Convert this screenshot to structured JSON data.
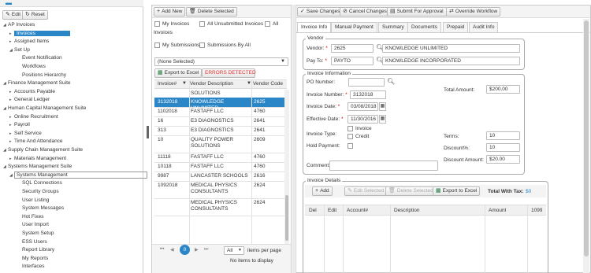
{
  "sidebar": {
    "edit_label": "Edit",
    "reset_label": "Reset",
    "items": [
      {
        "label": "AP Invoices",
        "level": 0
      },
      {
        "label": "Invoices",
        "level": 1,
        "selected": true
      },
      {
        "label": "Assigned Items",
        "level": 1
      },
      {
        "label": "Set Up",
        "level": 1
      },
      {
        "label": "Event Notification",
        "level": 2
      },
      {
        "label": "Workflows",
        "level": 2
      },
      {
        "label": "Positions Hierarchy",
        "level": 2
      },
      {
        "label": "Finance Management Suite",
        "level": 0
      },
      {
        "label": "Accounts Payable",
        "level": 1
      },
      {
        "label": "General Ledger",
        "level": 1
      },
      {
        "label": "Human Capital Management Suite",
        "level": 0
      },
      {
        "label": "Online Recruitment",
        "level": 1
      },
      {
        "label": "Payroll",
        "level": 1
      },
      {
        "label": "Self Service",
        "level": 1
      },
      {
        "label": "Time And Attendance",
        "level": 1
      },
      {
        "label": "Supply Chain Management Suite",
        "level": 0
      },
      {
        "label": "Materials Management",
        "level": 1
      },
      {
        "label": "Systems Management Suite",
        "level": 0
      },
      {
        "label": "Systems Management",
        "level": 1
      },
      {
        "label": "SQL Connections",
        "level": 2
      },
      {
        "label": "Security Groups",
        "level": 2
      },
      {
        "label": "User Listing",
        "level": 2
      },
      {
        "label": "System Messages",
        "level": 2
      },
      {
        "label": "Hot Fixes",
        "level": 2
      },
      {
        "label": "User Import",
        "level": 2
      },
      {
        "label": "System Setup",
        "level": 2
      },
      {
        "label": "ESS Users",
        "level": 2
      },
      {
        "label": "Report Library",
        "level": 2
      },
      {
        "label": "My Reports",
        "level": 2
      },
      {
        "label": "Interfaces",
        "level": 2
      }
    ]
  },
  "list": {
    "add_new": "Add New",
    "delete_selected": "Delete Selected",
    "filters": {
      "my_invoices": "My Invoices",
      "all_unsubmitted": "All Unsubmitted Invoices",
      "all": "All",
      "invoices_word": "Invoices",
      "my_submissions": "My Submissions",
      "submissions_by_all": "Submissions By All"
    },
    "dropdown_value": "(None Selected)",
    "export_label": "Export to Excel",
    "errors_label": "ERRORS DETECTED",
    "columns": [
      "Invoice#",
      "Vendor Description",
      "Vendor Code"
    ],
    "rows": [
      {
        "invoice": "",
        "vendor": "SOLUTIONS",
        "code": ""
      },
      {
        "invoice": "3132018",
        "vendor": "KNOWLEDGE UNLIMITED",
        "code": "2625",
        "selected": true
      },
      {
        "invoice": "1102018",
        "vendor": "FASTAFF LLC",
        "code": "4760"
      },
      {
        "invoice": "16",
        "vendor": "E3 DIAGNOSTICS",
        "code": "2641"
      },
      {
        "invoice": "313",
        "vendor": "E3 DIAGNOSTICS",
        "code": "2641"
      },
      {
        "invoice": "10",
        "vendor": "QUALITY POWER SOLUTIONS",
        "code": "2609"
      },
      {
        "invoice": "11118",
        "vendor": "FASTAFF LLC",
        "code": "4760"
      },
      {
        "invoice": "10118",
        "vendor": "FASTAFF LLC",
        "code": "4760"
      },
      {
        "invoice": "9987",
        "vendor": "LANCASTER SCHOOLS",
        "code": "2616"
      },
      {
        "invoice": "1092018",
        "vendor": "MEDICAL PHYSICS CONSULTANTS",
        "code": "2624"
      },
      {
        "invoice": "",
        "vendor": "MEDICAL PHYSICS CONSULTANTS",
        "code": "2624"
      }
    ],
    "pager": {
      "current_page": "0",
      "page_size": "All",
      "items_per_page": "items per page",
      "no_items": "No items to display"
    }
  },
  "detail": {
    "toolbar": {
      "save": "Save Changes",
      "cancel": "Cancel Changes",
      "submit": "Submit For Approval",
      "override": "Override Workflow"
    },
    "tabs": [
      "Invoice Info",
      "Manual Payment",
      "Summary",
      "Documents",
      "Prepaid",
      "Audit Info"
    ],
    "vendor": {
      "legend": "Vendor",
      "vendor_label": "Vendor:",
      "vendor_code": "2625",
      "vendor_name": "KNOWLEDGE UNLIMITED",
      "payto_label": "Pay To:",
      "payto_code": "PAYTO",
      "payto_name": "KNOWLEDGE INCORPORATED"
    },
    "invoice": {
      "legend": "Invoice Information",
      "po_label": "PO Number:",
      "po_value": "",
      "number_label": "Invoice Number:",
      "number_value": "3132018",
      "date_label": "Invoice Date:",
      "date_value": "03/08/2018",
      "effective_label": "Effective Date:",
      "effective_value": "11/30/2016",
      "type_label": "Invoice Type:",
      "type_invoice": "Invoice",
      "type_credit": "Credit",
      "hold_label": "Hold Payment:",
      "comment_label": "Comment:",
      "comment_value": "",
      "total_label": "Total Amount:",
      "total_value": "$200.00",
      "terms_label": "Terms:",
      "terms_value": "10",
      "discount_pct_label": "Discount%:",
      "discount_pct_value": "10",
      "discount_amt_label": "Discount Amount:",
      "discount_amt_value": "$20.00"
    },
    "details": {
      "legend": "Invoice Details",
      "add": "Add",
      "edit_selected": "Edit Selected",
      "delete_selected": "Delete Selected",
      "export": "Export to Excel",
      "total_with_tax_label": "Total With Tax:",
      "total_with_tax_value": "$0",
      "columns": [
        "Del",
        "Edit",
        "Account#",
        "Description",
        "Amount",
        "1099"
      ]
    }
  },
  "colors": {
    "selected_blue": "#2b86c8",
    "error_red": "#d9302a",
    "accent_blue": "#2b86c8"
  }
}
